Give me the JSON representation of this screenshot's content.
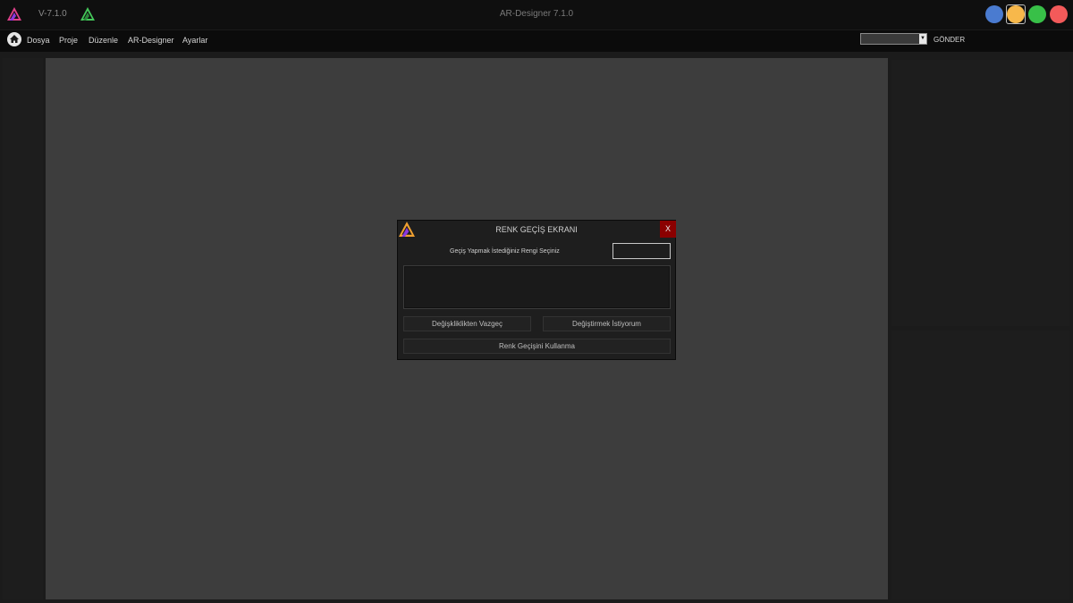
{
  "titlebar": {
    "version": "V-7.1.0",
    "title": "AR-Designer 7.1.0",
    "window_buttons": [
      {
        "name": "blue-circle",
        "color": "#4a7bd0"
      },
      {
        "name": "yellow-circle",
        "color": "#f7b84b"
      },
      {
        "name": "green-circle",
        "color": "#38c048"
      },
      {
        "name": "red-circle",
        "color": "#f35a5a"
      }
    ]
  },
  "menubar": {
    "items": [
      "Dosya",
      "Proje",
      "Düzenle",
      "AR-Designer",
      "Ayarlar"
    ],
    "send_label": "GÖNDER",
    "select_value": ""
  },
  "dialog": {
    "title": "RENK GEÇİŞ EKRANI",
    "close_label": "X",
    "prompt": "Geçiş Yapmak İstediğiniz Rengi Seçiniz",
    "btn_discard": "Değişkliklikten Vazgeç",
    "btn_apply": "Değiştirmek İstiyorum",
    "btn_no_gradient": "Renk Geçişini Kullanma"
  },
  "colors": {
    "canvas": "#3d3d3d",
    "dialog_close": "#8b0000",
    "logo_pink": "#e0408a",
    "logo_purple": "#8a38e0",
    "logo_green": "#44c85a"
  }
}
